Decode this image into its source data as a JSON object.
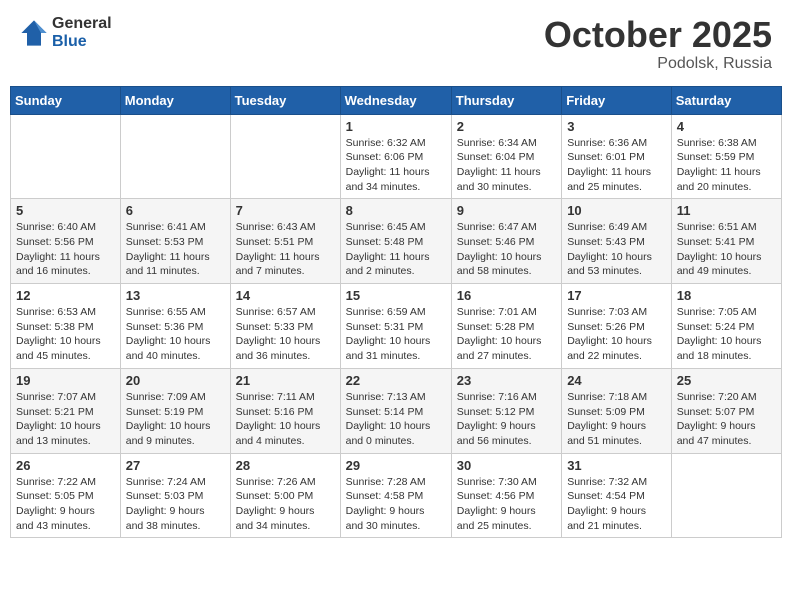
{
  "header": {
    "logo_general": "General",
    "logo_blue": "Blue",
    "month_title": "October 2025",
    "subtitle": "Podolsk, Russia"
  },
  "weekdays": [
    "Sunday",
    "Monday",
    "Tuesday",
    "Wednesday",
    "Thursday",
    "Friday",
    "Saturday"
  ],
  "weeks": [
    [
      {
        "day": "",
        "info": ""
      },
      {
        "day": "",
        "info": ""
      },
      {
        "day": "",
        "info": ""
      },
      {
        "day": "1",
        "info": "Sunrise: 6:32 AM\nSunset: 6:06 PM\nDaylight: 11 hours\nand 34 minutes."
      },
      {
        "day": "2",
        "info": "Sunrise: 6:34 AM\nSunset: 6:04 PM\nDaylight: 11 hours\nand 30 minutes."
      },
      {
        "day": "3",
        "info": "Sunrise: 6:36 AM\nSunset: 6:01 PM\nDaylight: 11 hours\nand 25 minutes."
      },
      {
        "day": "4",
        "info": "Sunrise: 6:38 AM\nSunset: 5:59 PM\nDaylight: 11 hours\nand 20 minutes."
      }
    ],
    [
      {
        "day": "5",
        "info": "Sunrise: 6:40 AM\nSunset: 5:56 PM\nDaylight: 11 hours\nand 16 minutes."
      },
      {
        "day": "6",
        "info": "Sunrise: 6:41 AM\nSunset: 5:53 PM\nDaylight: 11 hours\nand 11 minutes."
      },
      {
        "day": "7",
        "info": "Sunrise: 6:43 AM\nSunset: 5:51 PM\nDaylight: 11 hours\nand 7 minutes."
      },
      {
        "day": "8",
        "info": "Sunrise: 6:45 AM\nSunset: 5:48 PM\nDaylight: 11 hours\nand 2 minutes."
      },
      {
        "day": "9",
        "info": "Sunrise: 6:47 AM\nSunset: 5:46 PM\nDaylight: 10 hours\nand 58 minutes."
      },
      {
        "day": "10",
        "info": "Sunrise: 6:49 AM\nSunset: 5:43 PM\nDaylight: 10 hours\nand 53 minutes."
      },
      {
        "day": "11",
        "info": "Sunrise: 6:51 AM\nSunset: 5:41 PM\nDaylight: 10 hours\nand 49 minutes."
      }
    ],
    [
      {
        "day": "12",
        "info": "Sunrise: 6:53 AM\nSunset: 5:38 PM\nDaylight: 10 hours\nand 45 minutes."
      },
      {
        "day": "13",
        "info": "Sunrise: 6:55 AM\nSunset: 5:36 PM\nDaylight: 10 hours\nand 40 minutes."
      },
      {
        "day": "14",
        "info": "Sunrise: 6:57 AM\nSunset: 5:33 PM\nDaylight: 10 hours\nand 36 minutes."
      },
      {
        "day": "15",
        "info": "Sunrise: 6:59 AM\nSunset: 5:31 PM\nDaylight: 10 hours\nand 31 minutes."
      },
      {
        "day": "16",
        "info": "Sunrise: 7:01 AM\nSunset: 5:28 PM\nDaylight: 10 hours\nand 27 minutes."
      },
      {
        "day": "17",
        "info": "Sunrise: 7:03 AM\nSunset: 5:26 PM\nDaylight: 10 hours\nand 22 minutes."
      },
      {
        "day": "18",
        "info": "Sunrise: 7:05 AM\nSunset: 5:24 PM\nDaylight: 10 hours\nand 18 minutes."
      }
    ],
    [
      {
        "day": "19",
        "info": "Sunrise: 7:07 AM\nSunset: 5:21 PM\nDaylight: 10 hours\nand 13 minutes."
      },
      {
        "day": "20",
        "info": "Sunrise: 7:09 AM\nSunset: 5:19 PM\nDaylight: 10 hours\nand 9 minutes."
      },
      {
        "day": "21",
        "info": "Sunrise: 7:11 AM\nSunset: 5:16 PM\nDaylight: 10 hours\nand 4 minutes."
      },
      {
        "day": "22",
        "info": "Sunrise: 7:13 AM\nSunset: 5:14 PM\nDaylight: 10 hours\nand 0 minutes."
      },
      {
        "day": "23",
        "info": "Sunrise: 7:16 AM\nSunset: 5:12 PM\nDaylight: 9 hours\nand 56 minutes."
      },
      {
        "day": "24",
        "info": "Sunrise: 7:18 AM\nSunset: 5:09 PM\nDaylight: 9 hours\nand 51 minutes."
      },
      {
        "day": "25",
        "info": "Sunrise: 7:20 AM\nSunset: 5:07 PM\nDaylight: 9 hours\nand 47 minutes."
      }
    ],
    [
      {
        "day": "26",
        "info": "Sunrise: 7:22 AM\nSunset: 5:05 PM\nDaylight: 9 hours\nand 43 minutes."
      },
      {
        "day": "27",
        "info": "Sunrise: 7:24 AM\nSunset: 5:03 PM\nDaylight: 9 hours\nand 38 minutes."
      },
      {
        "day": "28",
        "info": "Sunrise: 7:26 AM\nSunset: 5:00 PM\nDaylight: 9 hours\nand 34 minutes."
      },
      {
        "day": "29",
        "info": "Sunrise: 7:28 AM\nSunset: 4:58 PM\nDaylight: 9 hours\nand 30 minutes."
      },
      {
        "day": "30",
        "info": "Sunrise: 7:30 AM\nSunset: 4:56 PM\nDaylight: 9 hours\nand 25 minutes."
      },
      {
        "day": "31",
        "info": "Sunrise: 7:32 AM\nSunset: 4:54 PM\nDaylight: 9 hours\nand 21 minutes."
      },
      {
        "day": "",
        "info": ""
      }
    ]
  ]
}
